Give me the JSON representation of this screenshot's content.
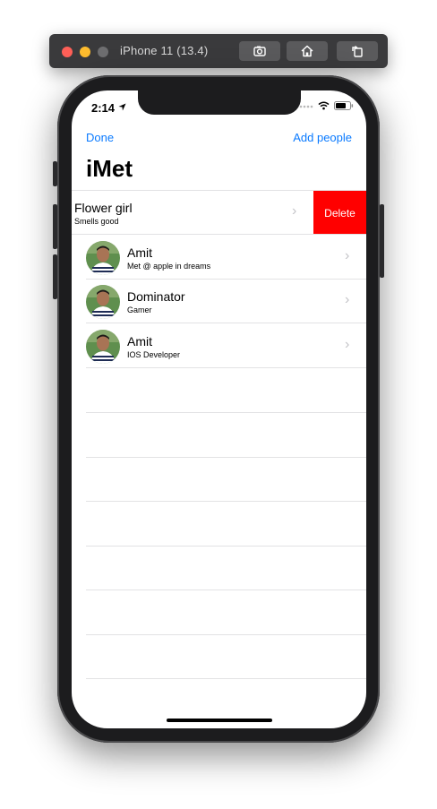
{
  "window": {
    "title": "iPhone 11 (13.4)",
    "tools": [
      {
        "icon": "screenshot-icon"
      },
      {
        "icon": "home-icon"
      },
      {
        "icon": "rotate-icon"
      }
    ]
  },
  "status_bar": {
    "time": "2:14",
    "location_icon": "location-arrow-icon",
    "signal_icon": "signal-dots-icon",
    "wifi_icon": "wifi-icon",
    "battery_icon": "battery-icon"
  },
  "nav": {
    "left_label": "Done",
    "right_label": "Add people",
    "title": "iMet",
    "accent_color": "#0a7aff"
  },
  "swiped_row": {
    "title": "Flower girl",
    "subtitle": "Smells good",
    "action_label": "Delete",
    "action_color": "#ff0000"
  },
  "people": [
    {
      "name": "Amit",
      "note": "Met @ apple in dreams"
    },
    {
      "name": "Dominator",
      "note": "Gamer"
    },
    {
      "name": "Amit",
      "note": "IOS Developer"
    }
  ]
}
